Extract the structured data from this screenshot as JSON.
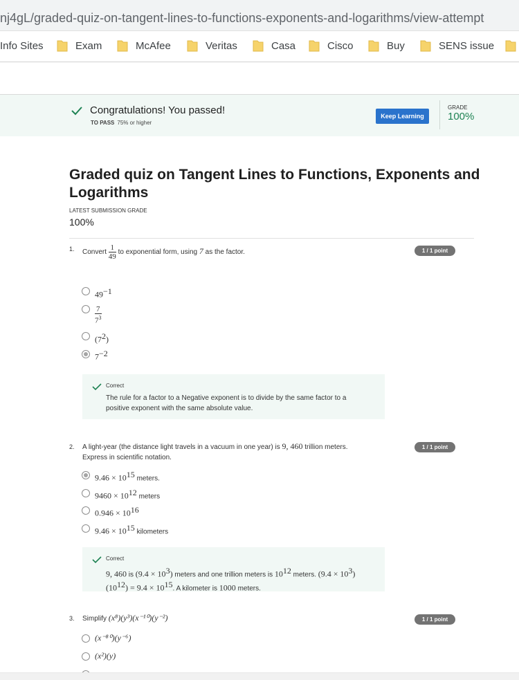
{
  "browser": {
    "url": "nj4gL/graded-quiz-on-tangent-lines-to-functions-exponents-and-logarithms/view-attempt",
    "bookmarks": [
      "Info Sites",
      "Exam",
      "McAfee",
      "Veritas",
      "Casa",
      "Cisco",
      "Buy",
      "SENS issue"
    ]
  },
  "banner": {
    "message": "Congratulations! You passed!",
    "to_pass_label": "TO PASS",
    "to_pass_value": "75% or higher",
    "button_label": "Keep Learning",
    "grade_label": "GRADE",
    "grade_value": "100%"
  },
  "quiz": {
    "title": "Graded quiz on Tangent Lines to Functions, Exponents and Logarithms",
    "latest_label": "LATEST SUBMISSION GRADE",
    "latest_value": "100%"
  },
  "questions": [
    {
      "number": "1.",
      "text_pre": "Convert",
      "fraction_num": "1",
      "fraction_den": "49",
      "text_mid": "to exponential form, using",
      "factor": "7",
      "text_post": "as the factor.",
      "score": "1 / 1 point",
      "options": [
        "49",
        "7",
        "(7",
        "7"
      ],
      "option_sups": [
        "−1",
        "3",
        "2",
        "−2"
      ],
      "option_suffix": [
        "",
        "",
        ")",
        ""
      ],
      "selected_index": 3,
      "feedback_label": "Correct",
      "feedback_text": "The rule for a factor to a Negative exponent is to divide by the same factor to a positive exponent with the same absolute value."
    },
    {
      "number": "2.",
      "text_a": "A light-year (the distance light travels in a vacuum in one year) is",
      "text_value": "9, 460",
      "text_b": "trillion meters.",
      "text_c": "Express in scientific notation.",
      "score": "1 / 1 point",
      "options": [
        {
          "math": "9.46 × 10",
          "sup": "15",
          "suffix": "meters."
        },
        {
          "math": "9460 × 10",
          "sup": "12",
          "suffix": "meters"
        },
        {
          "math": "0.946 × 10",
          "sup": "16",
          "suffix": ""
        },
        {
          "math": "9.46 × 10",
          "sup": "15",
          "suffix": "kilometers"
        }
      ],
      "selected_index": 0,
      "feedback_label": "Correct",
      "fb_v1": "9, 460",
      "fb_t1": "is",
      "fb_v2": "(9.4 × 10",
      "fb_s2": "3",
      "fb_t2": "meters and one trillion meters is",
      "fb_v3": "10",
      "fb_s3": "12",
      "fb_t3": "meters.",
      "fb_v4": "(9.4 ×",
      "fb_v5": "10",
      "fb_s5": "3",
      "fb_v6": ")(10",
      "fb_s6": "12",
      "fb_t4": ") = 9.4 × 10",
      "fb_s7": "15",
      "fb_t5": ". A kilometer is",
      "fb_v8": "1000",
      "fb_t6": "meters."
    },
    {
      "number": "3.",
      "text": "Simplify",
      "expr": "(x⁸)(y³)(x⁻¹⁰)(y⁻²)",
      "score": "1 / 1 point",
      "options": [
        "(x⁻⁸⁰)(y⁻⁶)",
        "(x²)(y)"
      ]
    }
  ],
  "colors": {
    "banner_bg": "#f1f8f5",
    "accent_green": "#1f8354",
    "button_blue": "#2a73cc",
    "pill_gray": "#737373"
  }
}
